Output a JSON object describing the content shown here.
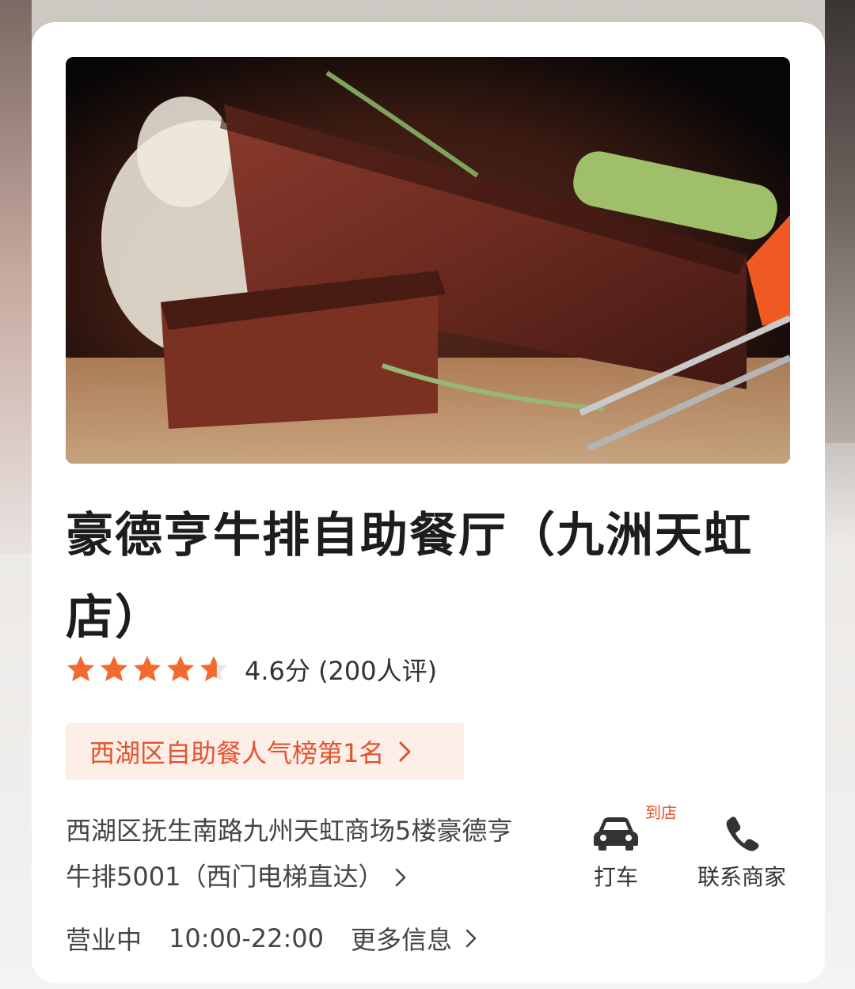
{
  "restaurant": {
    "name": "豪德亨牛排自助餐厅（九洲天虹店）",
    "rating_stars": 4.6,
    "rating_text": "4.6分 (200人评)",
    "rank_badge": "西湖区自助餐人气榜第1名",
    "address": "西湖区抚生南路九州天虹商场5楼豪德亨牛排5001（西门电梯直达）",
    "status": "营业中",
    "hours": "10:00-22:00",
    "more_info": "更多信息"
  },
  "actions": {
    "taxi_label": "打车",
    "taxi_tag": "到店",
    "contact_label": "联系商家"
  },
  "colors": {
    "accent": "#e2532b",
    "star": "#f26a2d",
    "badge_bg": "#fdeee8"
  },
  "icons": {
    "star": "star-icon",
    "chevron": "chevron-right-icon",
    "taxi": "car-icon",
    "phone": "phone-icon"
  }
}
